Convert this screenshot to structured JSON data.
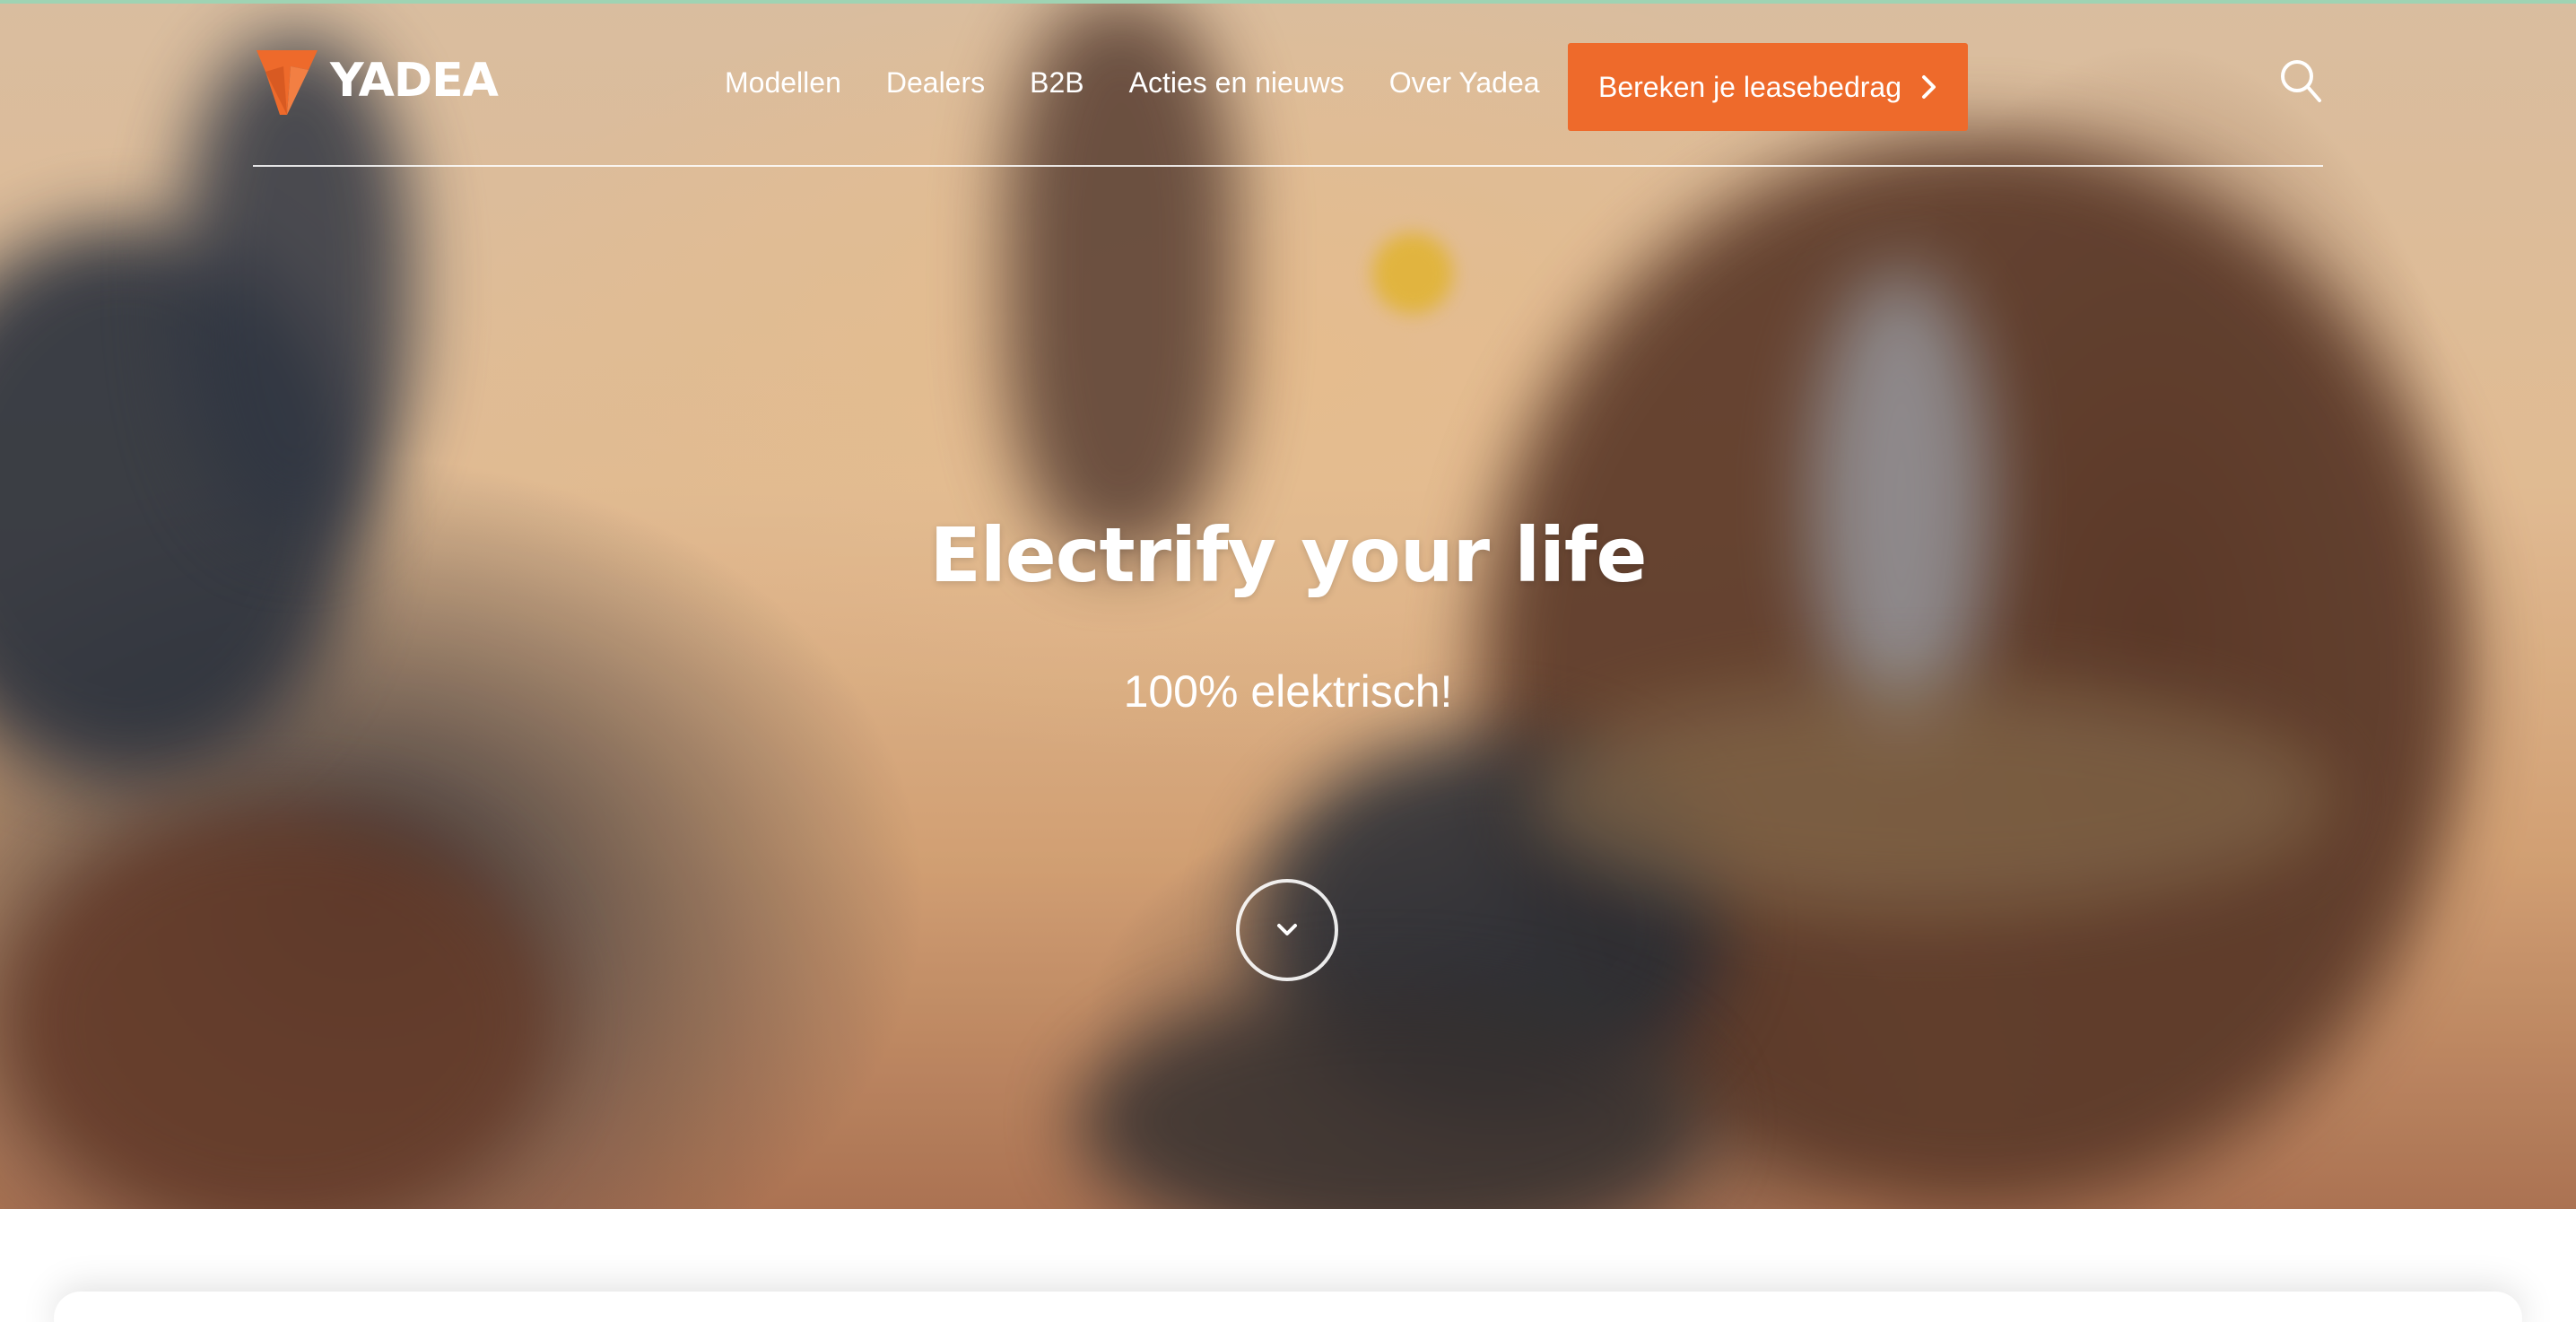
{
  "brand": {
    "name": "YADEA",
    "accent_color": "#ee6a2b",
    "logo_icon": "yadea-logo-icon"
  },
  "nav": {
    "items": [
      {
        "label": "Modellen"
      },
      {
        "label": "Dealers"
      },
      {
        "label": "B2B"
      },
      {
        "label": "Acties en nieuws"
      },
      {
        "label": "Over Yadea"
      }
    ],
    "cta_label": "Bereken je leasebedrag",
    "cta_icon": "chevron-right-icon",
    "search_icon": "search-icon"
  },
  "hero": {
    "title": "Electrify your life",
    "subtitle": "100% elektrisch!",
    "scroll_icon": "chevron-down-icon"
  }
}
